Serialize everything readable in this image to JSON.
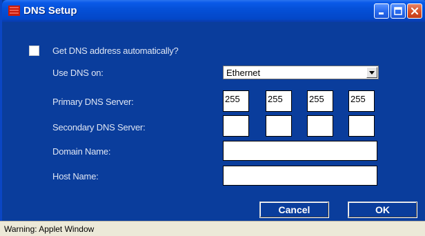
{
  "window": {
    "title": "DNS Setup"
  },
  "form": {
    "auto_dns": {
      "label": "Get DNS address automatically?",
      "checked": false
    },
    "use_dns_on": {
      "label": "Use DNS on:",
      "selected": "Ethernet"
    },
    "primary_dns": {
      "label": "Primary DNS Server:",
      "octets": [
        "255",
        "255",
        "255",
        "255"
      ]
    },
    "secondary_dns": {
      "label": "Secondary DNS Server:",
      "octets": [
        "",
        "",
        "",
        ""
      ]
    },
    "domain_name": {
      "label": "Domain Name:",
      "value": ""
    },
    "host_name": {
      "label": "Host Name:",
      "value": ""
    }
  },
  "buttons": {
    "cancel": "Cancel",
    "ok": "OK"
  },
  "status": {
    "text": "Warning: Applet Window"
  },
  "colors": {
    "background": "#0a3d9c",
    "titlebar": "#0550d8",
    "close_button": "#d9532a",
    "statusbar": "#ece9d8"
  },
  "icons": {
    "window": "java-applet-icon",
    "minimize": "minimize-icon",
    "maximize": "maximize-icon",
    "close": "close-icon",
    "dropdown": "chevron-down-icon"
  }
}
